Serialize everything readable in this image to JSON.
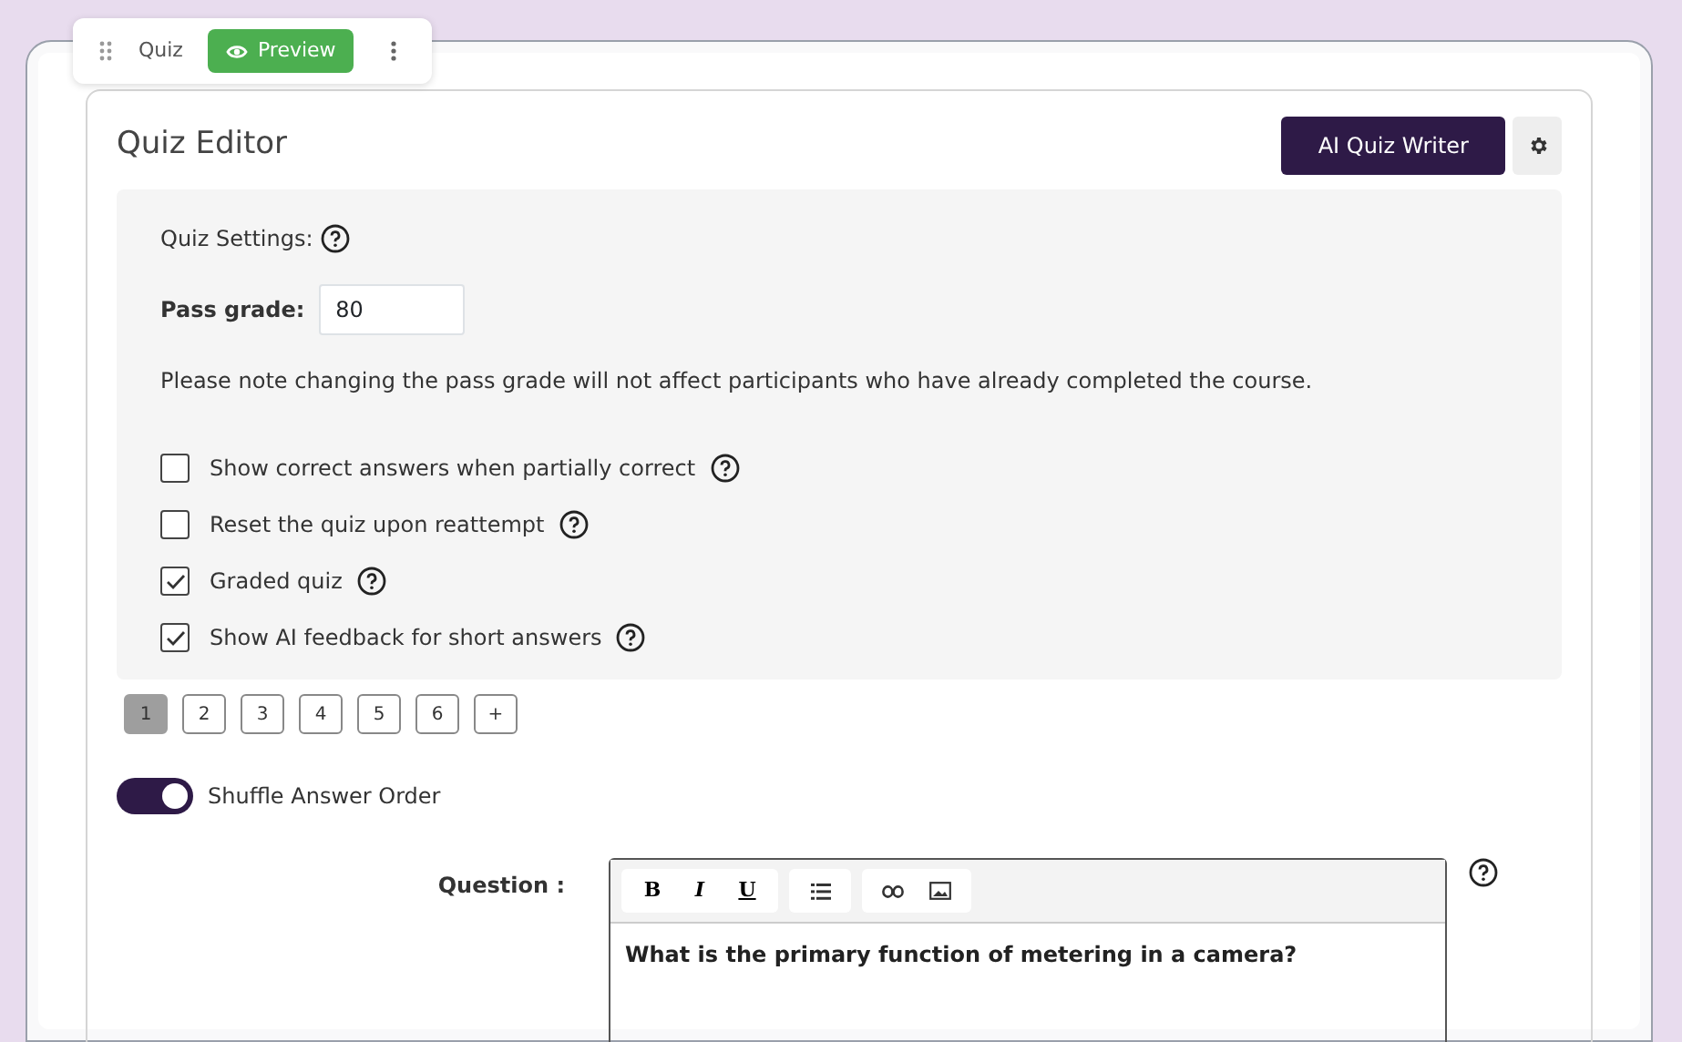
{
  "block_toolbar": {
    "label": "Quiz",
    "preview_button": "Preview"
  },
  "editor": {
    "title": "Quiz Editor",
    "ai_button": "AI Quiz Writer"
  },
  "settings": {
    "heading": "Quiz Settings:",
    "pass_grade_label": "Pass grade:",
    "pass_grade_value": "80",
    "note": "Please note changing the pass grade will not affect participants who have already completed the course.",
    "options": [
      {
        "label": "Show correct answers when partially correct",
        "checked": false
      },
      {
        "label": "Reset the quiz upon reattempt",
        "checked": false
      },
      {
        "label": "Graded quiz",
        "checked": true
      },
      {
        "label": "Show AI feedback for short answers",
        "checked": true
      }
    ]
  },
  "pages": [
    {
      "label": "1",
      "selected": true
    },
    {
      "label": "2",
      "selected": false
    },
    {
      "label": "3",
      "selected": false
    },
    {
      "label": "4",
      "selected": false
    },
    {
      "label": "5",
      "selected": false
    },
    {
      "label": "6",
      "selected": false
    }
  ],
  "add_page": "+",
  "shuffle": {
    "label": "Shuffle Answer Order",
    "on": true
  },
  "question": {
    "label": "Question :",
    "format_buttons": [
      "B",
      "I",
      "U"
    ],
    "text": "What is the primary function of metering in a camera?"
  }
}
